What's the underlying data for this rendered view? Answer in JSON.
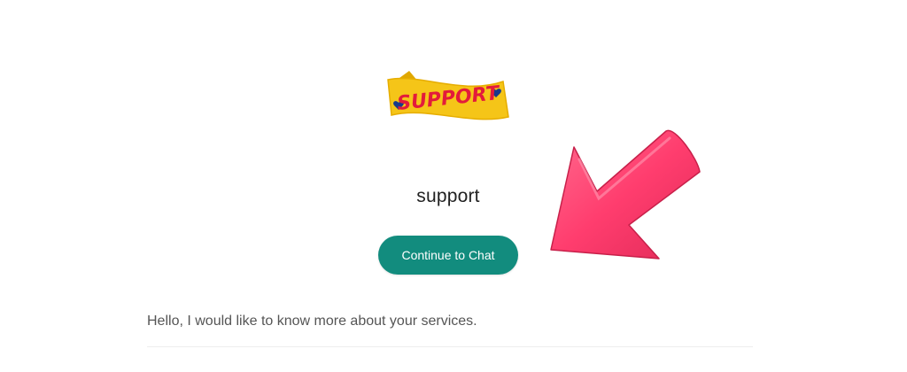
{
  "logo": {
    "text": "SUPPORT",
    "ribbon_color": "#f5c518",
    "text_color": "#e31b3b",
    "heart_color": "#1a3a8a"
  },
  "profile": {
    "name": "support"
  },
  "chat_button": {
    "label": "Continue to Chat",
    "color": "#128c7e"
  },
  "arrow": {
    "icon": "pointer-arrow-icon",
    "color": "#ff3d6e"
  },
  "message": {
    "text": "Hello, I would like to know more about your services."
  }
}
